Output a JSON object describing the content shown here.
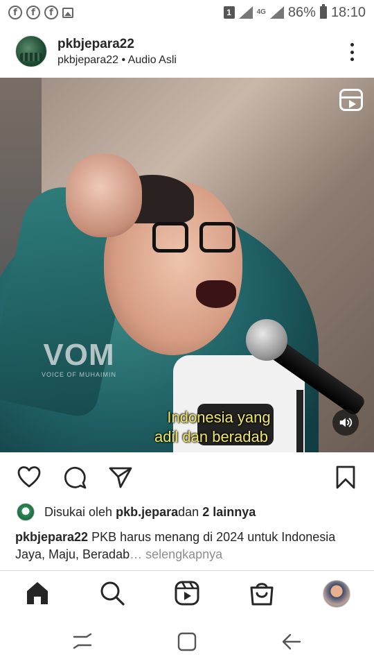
{
  "status_bar": {
    "notification_icons": [
      "facebook-icon",
      "facebook-icon",
      "facebook-icon",
      "gallery-icon"
    ],
    "sim_label": "1",
    "network_label": "4G",
    "battery_percent": "86%",
    "time": "18:10"
  },
  "post": {
    "username": "pkbjepara22",
    "subline": "pkbjepara22 • Audio Asli",
    "video": {
      "watermark_title": "VOM",
      "watermark_sub": "VOICE OF MUHAIMIN",
      "caption_line1": "Indonesia yang",
      "caption_line2": "adil dan beradab"
    },
    "likes": {
      "prefix": "Disukai oleh ",
      "user": "pkb.jepara",
      "middle": " dan ",
      "others": "2 lainnya"
    },
    "caption": {
      "username": "pkbjepara22",
      "text": " PKB harus menang di 2024 untuk Indonesia Jaya, Maju, Beradab",
      "more": "… selengkapnya"
    }
  },
  "colors": {
    "caption_yellow": "#f0e65c",
    "text": "#262626",
    "muted": "#8e8e8e"
  }
}
